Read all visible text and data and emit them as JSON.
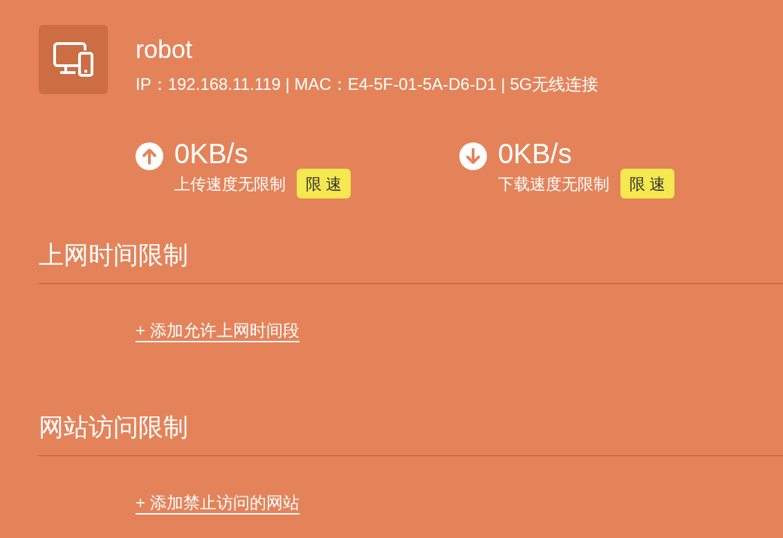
{
  "device": {
    "name": "robot",
    "info": "IP：192.168.11.119 | MAC：E4-5F-01-5A-D6-D1 | 5G无线连接"
  },
  "speeds": [
    {
      "kind": "upload",
      "rate": "0KB/s",
      "label": "上传速度无限制",
      "button": "限 速"
    },
    {
      "kind": "download",
      "rate": "0KB/s",
      "label": "下载速度无限制",
      "button": "限 速"
    }
  ],
  "sections": [
    {
      "title": "上网时间限制",
      "link": "+ 添加允许上网时间段"
    },
    {
      "title": "网站访问限制",
      "link": "+ 添加禁止访问的网站"
    }
  ]
}
